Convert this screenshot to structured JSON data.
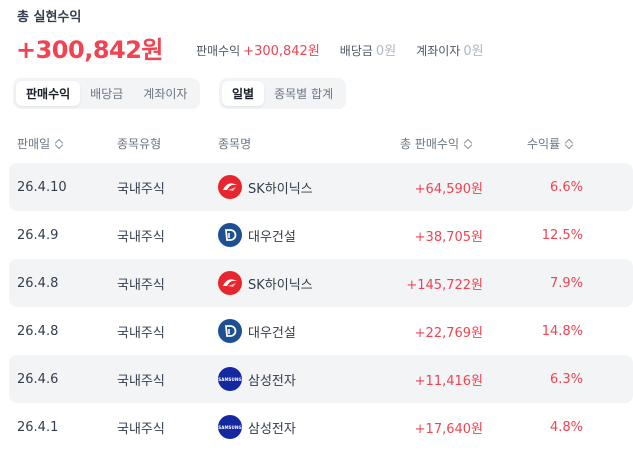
{
  "summary": {
    "title": "총 실현수익",
    "total": "+300,842원",
    "sales_label": "판매수익",
    "sales_value": "+300,842원",
    "dividend_label": "배당금",
    "dividend_value": "0원",
    "interest_label": "계좌이자",
    "interest_value": "0원"
  },
  "tabs": {
    "type": [
      "판매수익",
      "배당금",
      "계좌이자"
    ],
    "view": [
      "일별",
      "종목별 합계"
    ]
  },
  "columns": {
    "date": "판매일",
    "type": "종목유형",
    "name": "종목명",
    "amount": "총 판매수익",
    "rate": "수익률"
  },
  "rows": [
    {
      "date": "26.4.10",
      "type": "국내주식",
      "logo": "sk-hynix-icon",
      "name": "SK하이닉스",
      "amount": "+64,590원",
      "rate": "6.6%"
    },
    {
      "date": "26.4.9",
      "type": "국내주식",
      "logo": "daewoo-icon",
      "name": "대우건설",
      "amount": "+38,705원",
      "rate": "12.5%"
    },
    {
      "date": "26.4.8",
      "type": "국내주식",
      "logo": "sk-hynix-icon",
      "name": "SK하이닉스",
      "amount": "+145,722원",
      "rate": "7.9%"
    },
    {
      "date": "26.4.8",
      "type": "국내주식",
      "logo": "daewoo-icon",
      "name": "대우건설",
      "amount": "+22,769원",
      "rate": "14.8%"
    },
    {
      "date": "26.4.6",
      "type": "국내주식",
      "logo": "samsung-icon",
      "name": "삼성전자",
      "amount": "+11,416원",
      "rate": "6.3%"
    },
    {
      "date": "26.4.1",
      "type": "국내주식",
      "logo": "samsung-icon",
      "name": "삼성전자",
      "amount": "+17,640원",
      "rate": "4.8%"
    }
  ],
  "logo_text": {
    "samsung": "SAMSUNG"
  },
  "colors": {
    "profit": "#f04452",
    "text": "#333d4b",
    "muted": "#6b7684",
    "row_highlight": "#f2f4f6"
  }
}
